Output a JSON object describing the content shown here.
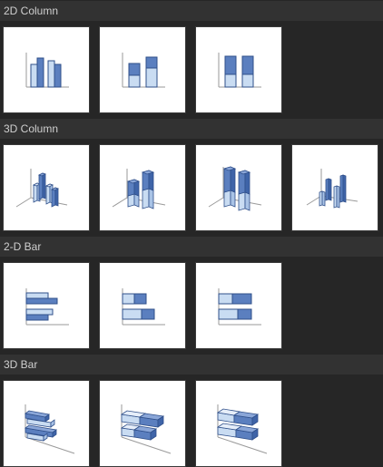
{
  "sections": [
    {
      "title": "2D Column"
    },
    {
      "title": "3D Column"
    },
    {
      "title": "2-D Bar"
    },
    {
      "title": "3D Bar"
    }
  ],
  "tiles": {
    "clustered_column_2d": "clustered-column-2d",
    "stacked_column_2d": "stacked-column-2d",
    "percent_stacked_column_2d": "percent-stacked-column-2d",
    "clustered_column_3d": "clustered-column-3d",
    "stacked_column_3d": "stacked-column-3d",
    "percent_stacked_column_3d": "percent-stacked-column-3d",
    "column_3d": "column-3d",
    "clustered_bar_2d": "clustered-bar-2d",
    "stacked_bar_2d": "stacked-bar-2d",
    "percent_stacked_bar_2d": "percent-stacked-bar-2d",
    "clustered_bar_3d": "clustered-bar-3d",
    "stacked_bar_3d": "stacked-bar-3d",
    "percent_stacked_bar_3d": "percent-stacked-bar-3d"
  },
  "colors": {
    "background": "#262626",
    "header_background": "#323232",
    "header_text": "#cfcfcf",
    "tile_background": "#ffffff",
    "series_dark": "#5b7fbf",
    "series_light": "#c9dcf2",
    "outline": "#2f4f8a",
    "axis": "#9a9a9a"
  }
}
